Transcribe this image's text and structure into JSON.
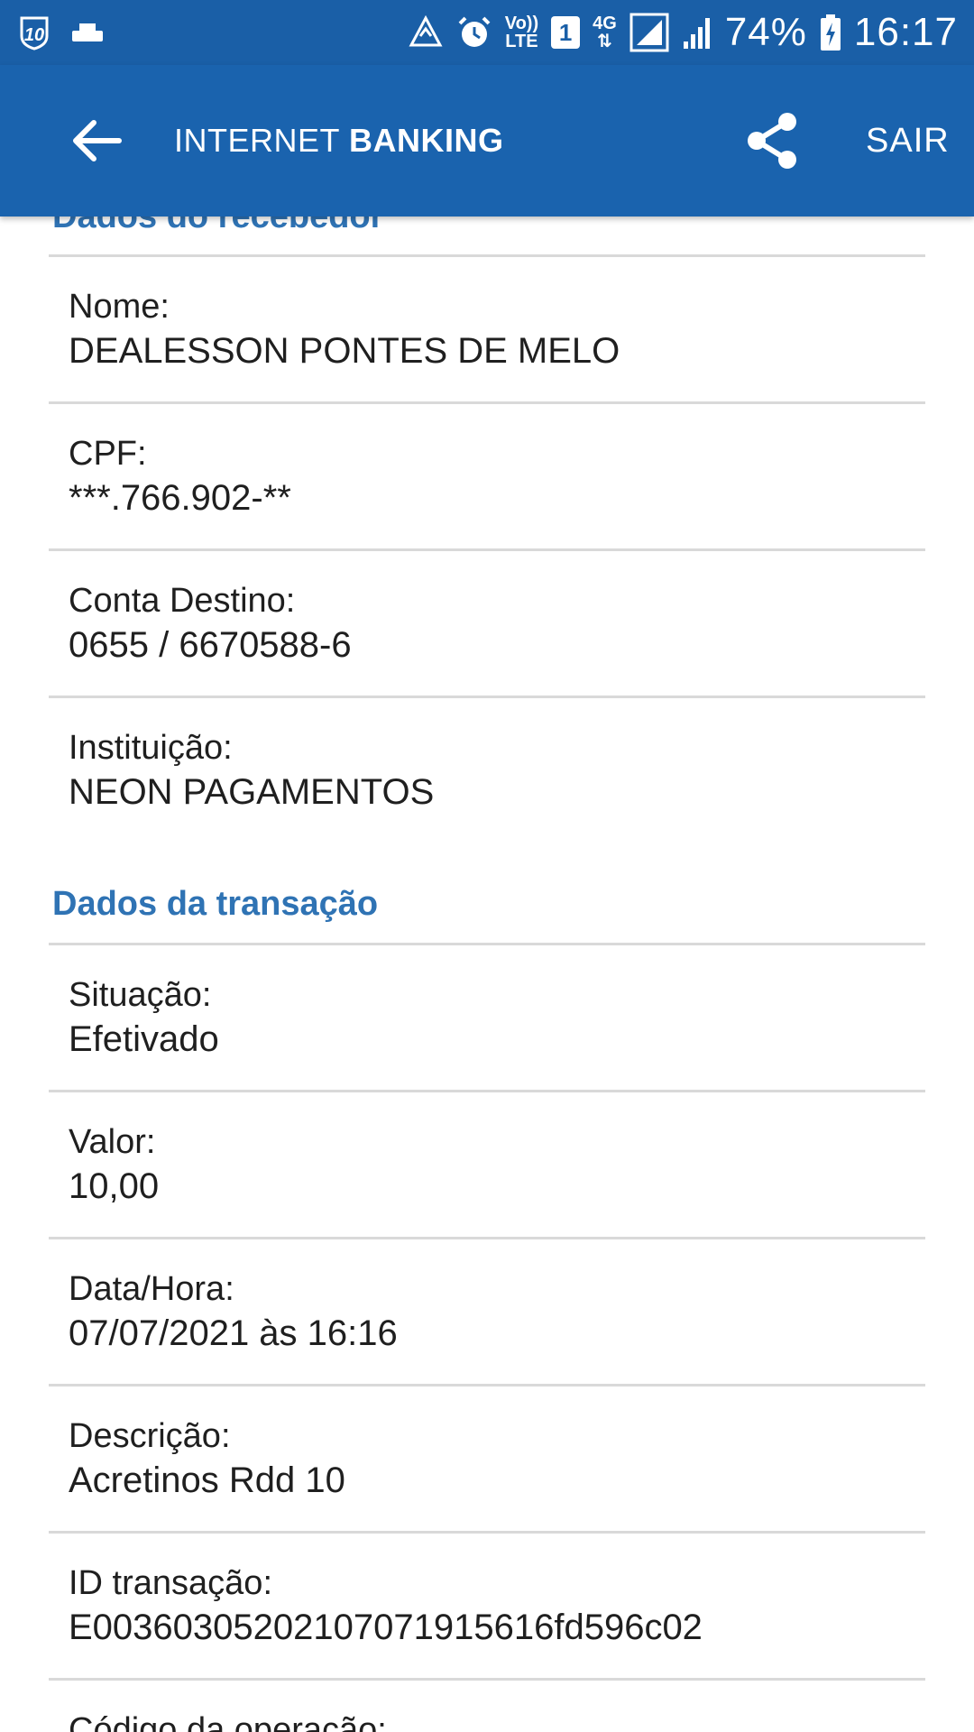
{
  "status_bar": {
    "battery_percent": "74%",
    "time": "16:17",
    "volte_line1": "Vo))",
    "volte_line2": "LTE",
    "sim_slot": "1",
    "network": "4G",
    "app_badge": "10"
  },
  "app_bar": {
    "title_regular": "INTERNET",
    "title_bold": "BANKING",
    "logout_label": "SAIR"
  },
  "receiver_section": {
    "title": "Dados do recebedor",
    "fields": [
      {
        "label": "Nome:",
        "value": "DEALESSON PONTES DE MELO"
      },
      {
        "label": "CPF:",
        "value": "***.766.902-**"
      },
      {
        "label": "Conta Destino:",
        "value": "0655 / 6670588-6"
      },
      {
        "label": "Instituição:",
        "value": "NEON PAGAMENTOS"
      }
    ]
  },
  "transaction_section": {
    "title": "Dados da transação",
    "fields": [
      {
        "label": "Situação:",
        "value": "Efetivado"
      },
      {
        "label": "Valor:",
        "value": "10,00"
      },
      {
        "label": "Data/Hora:",
        "value": "07/07/2021 às 16:16"
      },
      {
        "label": "Descrição:",
        "value": "Acretinos Rdd 10"
      },
      {
        "label": "ID transação:",
        "value": "E00360305202107071915616fd596c02"
      },
      {
        "label": "Código da operação:",
        "value": ""
      }
    ]
  },
  "colors": {
    "status_bar": "#1a5fa7",
    "app_bar": "#1a63ae",
    "section_title": "#2f73b4",
    "divider": "#d9d9d9",
    "text": "#1f1f1f"
  }
}
